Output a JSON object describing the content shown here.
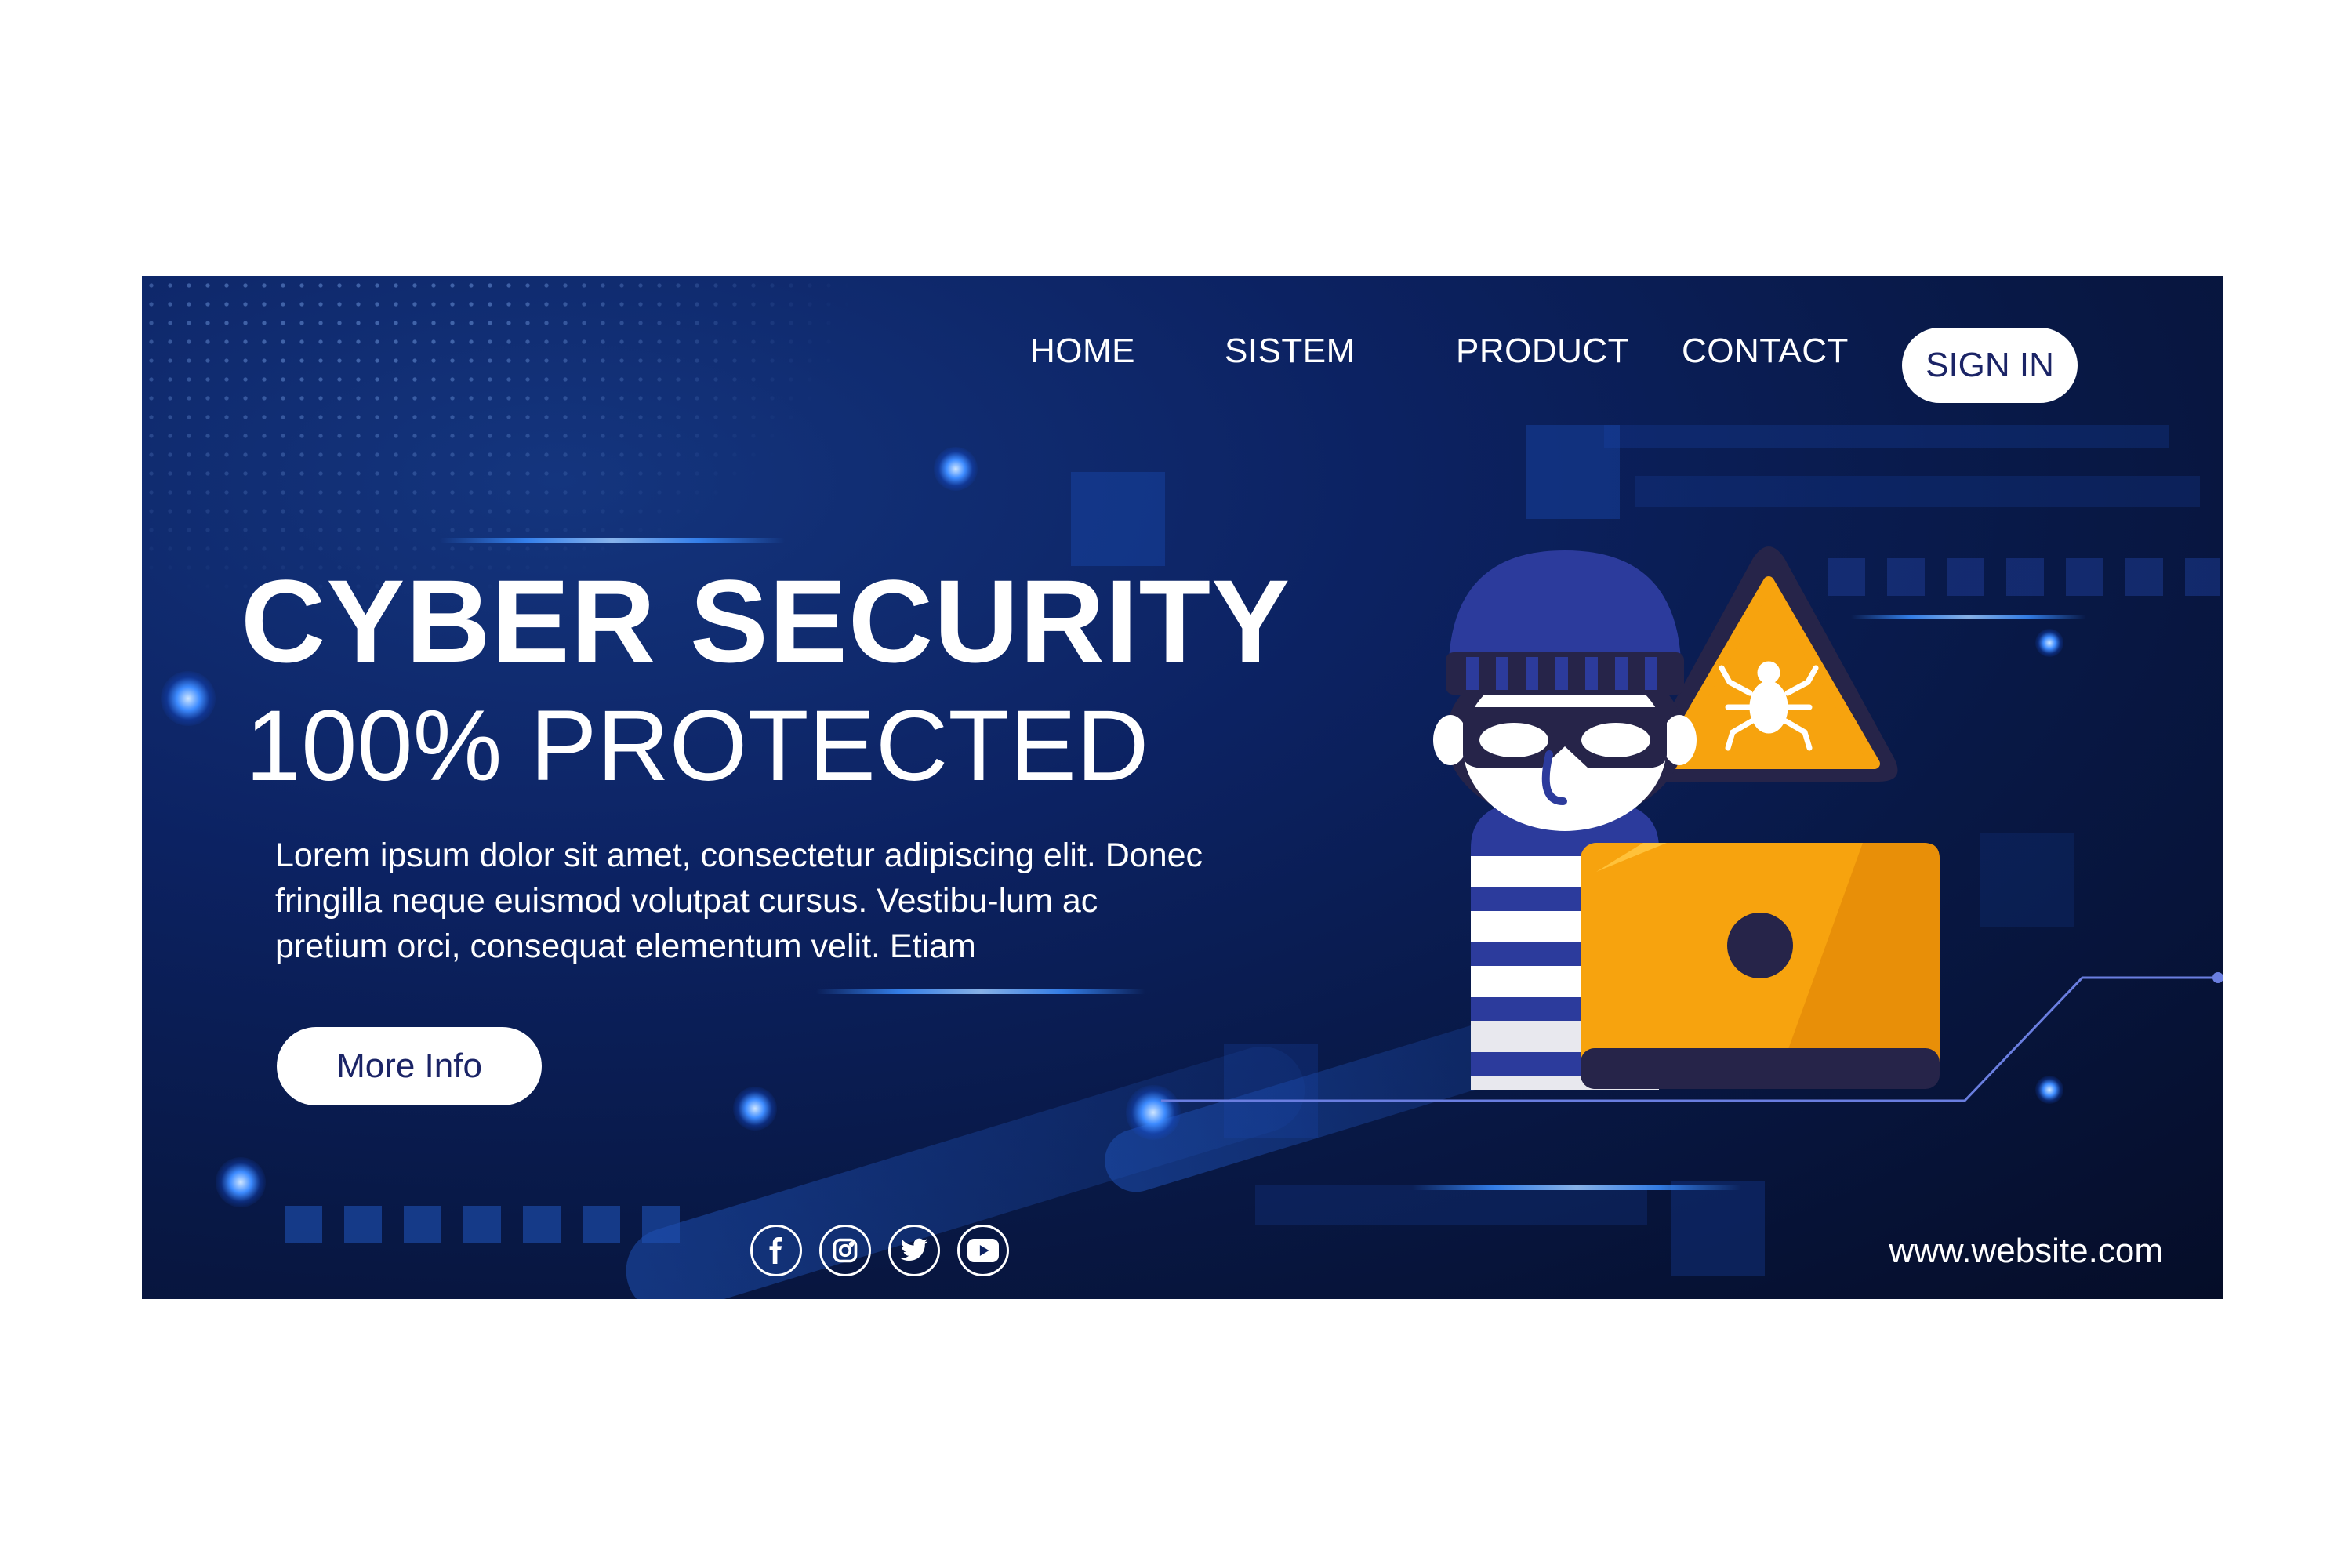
{
  "nav": {
    "items": [
      "HOME",
      "SISTEM",
      "PRODUCT",
      "CONTACT"
    ],
    "sign_in": "SIGN IN"
  },
  "hero": {
    "title": "CYBER SECURITY",
    "subtitle": "100% PROTECTED",
    "body": "Lorem ipsum dolor sit amet, consectetur adipiscing elit. Donec fringilla neque euismod volutpat cursus. Vestibu-lum ac pretium orci, consequat elementum velit. Etiam",
    "button": "More Info"
  },
  "social": {
    "icons": [
      "facebook-icon",
      "instagram-icon",
      "twitter-icon",
      "youtube-icon"
    ]
  },
  "footer": {
    "website": "www.website.com"
  },
  "colors": {
    "background": "#0c2262",
    "button_text": "#1b2466",
    "laptop": "#f7a30e",
    "warning": "#f7a30e",
    "hacker": "#2c3b9c"
  }
}
